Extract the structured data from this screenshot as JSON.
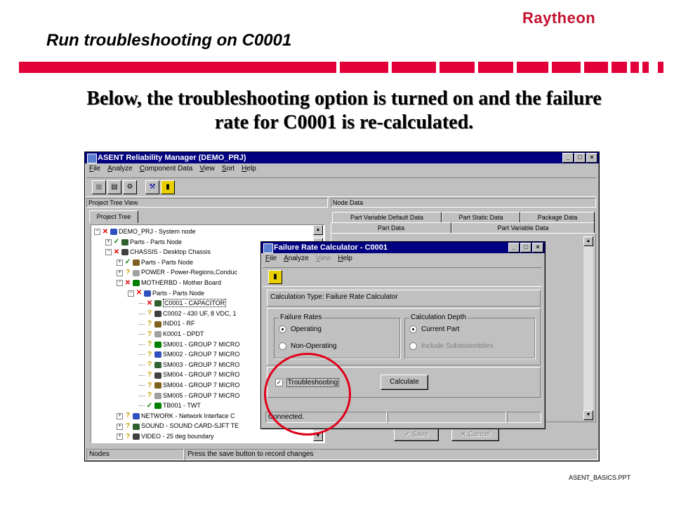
{
  "slide": {
    "title": "Run troubleshooting on C0001",
    "logo": "Raytheon",
    "caption_line1": "Below, the troubleshooting option is turned on and the failure",
    "caption_line2": "rate for C0001 is re-calculated.",
    "footer": "ASENT_BASICS.PPT"
  },
  "main_window": {
    "title": "ASENT Reliability Manager (DEMO_PRJ)",
    "menu": [
      "File",
      "Analyze",
      "Component Data",
      "View",
      "Sort",
      "Help"
    ],
    "left_panel_header": "Project Tree View",
    "left_tab": "Project Tree",
    "right_panel_header": "Node Data",
    "tabs_row1": [
      "Part Variable Default Data",
      "Part Static Data",
      "Package Data"
    ],
    "tabs_row2": [
      "Part Data",
      "Part Variable Data"
    ],
    "tree": [
      {
        "text": "DEMO_PRJ  -  System node",
        "mark": "✕",
        "mk": "x",
        "depth": 0,
        "exp": "−"
      },
      {
        "text": "Parts  -  Parts Node",
        "mark": "✓",
        "mk": "c",
        "depth": 1,
        "exp": "+"
      },
      {
        "text": "CHASSIS  -  Desktop Chassis",
        "mark": "✕",
        "mk": "x",
        "depth": 1,
        "exp": "−"
      },
      {
        "text": "Parts  -  Parts Node",
        "mark": "✓",
        "mk": "c",
        "depth": 2,
        "exp": "+"
      },
      {
        "text": "POWER  -  Power-Regions,Conduc",
        "mark": "?",
        "mk": "q",
        "depth": 2,
        "exp": "+"
      },
      {
        "text": "MOTHERBD  -  Mother Board",
        "mark": "✕",
        "mk": "x",
        "depth": 2,
        "exp": "−"
      },
      {
        "text": "Parts  -  Parts Node",
        "mark": "✕",
        "mk": "x",
        "depth": 3,
        "exp": "−"
      },
      {
        "text": "C0001  -  CAPACITOR",
        "mark": "✕",
        "mk": "x",
        "depth": 4,
        "exp": "",
        "sel": true
      },
      {
        "text": "C0002  -  430 UF, 8 VDC, 1",
        "mark": "?",
        "mk": "q",
        "depth": 4,
        "exp": ""
      },
      {
        "text": "IND01  -  RF",
        "mark": "?",
        "mk": "q",
        "depth": 4,
        "exp": ""
      },
      {
        "text": "K0001  -  DPDT",
        "mark": "?",
        "mk": "q",
        "depth": 4,
        "exp": ""
      },
      {
        "text": "SM001  -  GROUP 7 MICRO",
        "mark": "?",
        "mk": "q",
        "depth": 4,
        "exp": ""
      },
      {
        "text": "SM002  -  GROUP 7 MICRO",
        "mark": "?",
        "mk": "q",
        "depth": 4,
        "exp": ""
      },
      {
        "text": "SM003  -  GROUP 7 MICRO",
        "mark": "?",
        "mk": "q",
        "depth": 4,
        "exp": ""
      },
      {
        "text": "SM004  -  GROUP 7 MICRO",
        "mark": "?",
        "mk": "q",
        "depth": 4,
        "exp": ""
      },
      {
        "text": "SM004  -  GROUP 7 MICRO",
        "mark": "?",
        "mk": "q",
        "depth": 4,
        "exp": ""
      },
      {
        "text": "SM005  -  GROUP 7 MICRO",
        "mark": "?",
        "mk": "q",
        "depth": 4,
        "exp": ""
      },
      {
        "text": "TB001  -  TWT",
        "mark": "✓",
        "mk": "c",
        "depth": 4,
        "exp": ""
      },
      {
        "text": "NETWORK  -  Network Interface C",
        "mark": "?",
        "mk": "q",
        "depth": 2,
        "exp": "+"
      },
      {
        "text": "SOUND  -  SOUND CARD-SJFT TE",
        "mark": "?",
        "mk": "q",
        "depth": 2,
        "exp": "+"
      },
      {
        "text": "VIDEO  -  25 deg boundary",
        "mark": "?",
        "mk": "q",
        "depth": 2,
        "exp": "+"
      }
    ],
    "save_label": "Save",
    "cancel_label": "Cancel",
    "status_left": "Nodes",
    "status_right": "Press the save button to record changes"
  },
  "dialog": {
    "title": "Failure Rate Calculator - C0001",
    "menu": [
      "File",
      "Analyze",
      "View",
      "Help"
    ],
    "calc_type": "Calculation Type: Failure Rate Calculator",
    "failure_rates_label": "Failure Rates",
    "operating": "Operating",
    "non_operating": "Non-Operating",
    "calc_depth_label": "Calculation Depth",
    "current_part": "Current Part",
    "include_sub": "Include Subassemblies",
    "troubleshooting": "Troubleshooting",
    "calculate": "Calculate",
    "status": "Connected."
  },
  "colors": {
    "accent_red": "#e2003a",
    "titlebar": "#000080",
    "highlight_circle": "#e0001a"
  }
}
